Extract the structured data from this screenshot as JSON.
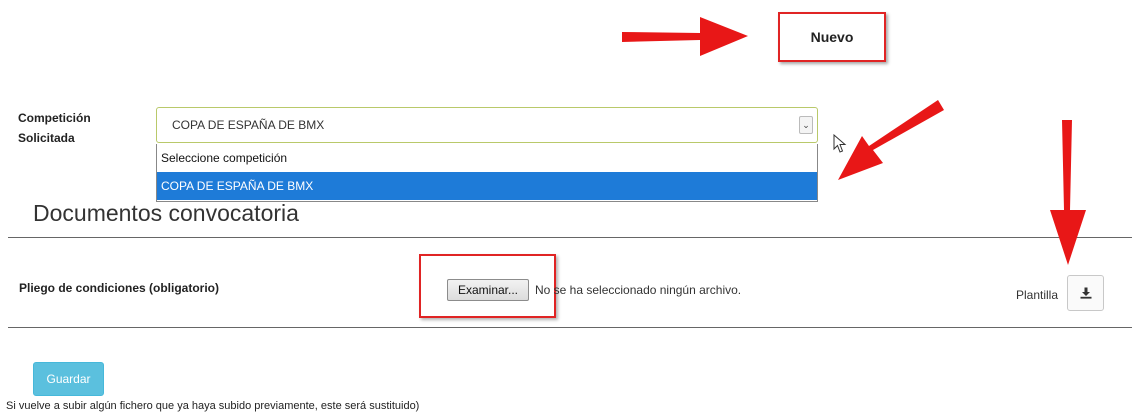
{
  "header": {
    "nuevo_label": "Nuevo"
  },
  "competition": {
    "label_line1": "Competición",
    "label_line2": "Solicitada",
    "selected_value": "COPA DE ESPAÑA DE BMX",
    "options": [
      "Seleccione competición",
      "COPA DE ESPAÑA DE BMX"
    ],
    "highlighted_option_index": 1
  },
  "documents": {
    "section_title": "Documentos convocatoria",
    "row_label": "Pliego de condiciones (obligatorio)",
    "browse_label": "Examinar...",
    "file_status": "No se ha seleccionado ningún archivo.",
    "template_label": "Plantilla",
    "template_icon": "download-icon"
  },
  "actions": {
    "save_label": "Guardar"
  },
  "footer": {
    "note": "Si vuelve a subir algún fichero que ya haya subido previamente, este será sustituido)"
  },
  "colors": {
    "annotation_red": "#e02424",
    "save_button": "#5bc0de",
    "selected_option": "#1e7bd8"
  }
}
